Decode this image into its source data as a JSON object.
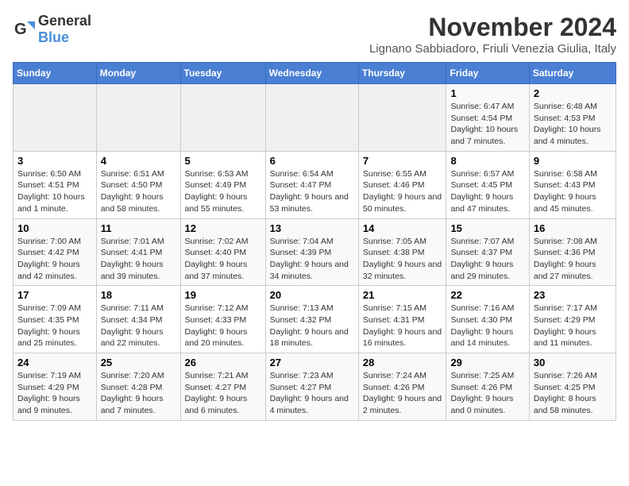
{
  "logo": {
    "text_general": "General",
    "text_blue": "Blue"
  },
  "title": "November 2024",
  "subtitle": "Lignano Sabbiadoro, Friuli Venezia Giulia, Italy",
  "days_of_week": [
    "Sunday",
    "Monday",
    "Tuesday",
    "Wednesday",
    "Thursday",
    "Friday",
    "Saturday"
  ],
  "weeks": [
    [
      {
        "day": "",
        "info": ""
      },
      {
        "day": "",
        "info": ""
      },
      {
        "day": "",
        "info": ""
      },
      {
        "day": "",
        "info": ""
      },
      {
        "day": "",
        "info": ""
      },
      {
        "day": "1",
        "info": "Sunrise: 6:47 AM\nSunset: 4:54 PM\nDaylight: 10 hours and 7 minutes."
      },
      {
        "day": "2",
        "info": "Sunrise: 6:48 AM\nSunset: 4:53 PM\nDaylight: 10 hours and 4 minutes."
      }
    ],
    [
      {
        "day": "3",
        "info": "Sunrise: 6:50 AM\nSunset: 4:51 PM\nDaylight: 10 hours and 1 minute."
      },
      {
        "day": "4",
        "info": "Sunrise: 6:51 AM\nSunset: 4:50 PM\nDaylight: 9 hours and 58 minutes."
      },
      {
        "day": "5",
        "info": "Sunrise: 6:53 AM\nSunset: 4:49 PM\nDaylight: 9 hours and 55 minutes."
      },
      {
        "day": "6",
        "info": "Sunrise: 6:54 AM\nSunset: 4:47 PM\nDaylight: 9 hours and 53 minutes."
      },
      {
        "day": "7",
        "info": "Sunrise: 6:55 AM\nSunset: 4:46 PM\nDaylight: 9 hours and 50 minutes."
      },
      {
        "day": "8",
        "info": "Sunrise: 6:57 AM\nSunset: 4:45 PM\nDaylight: 9 hours and 47 minutes."
      },
      {
        "day": "9",
        "info": "Sunrise: 6:58 AM\nSunset: 4:43 PM\nDaylight: 9 hours and 45 minutes."
      }
    ],
    [
      {
        "day": "10",
        "info": "Sunrise: 7:00 AM\nSunset: 4:42 PM\nDaylight: 9 hours and 42 minutes."
      },
      {
        "day": "11",
        "info": "Sunrise: 7:01 AM\nSunset: 4:41 PM\nDaylight: 9 hours and 39 minutes."
      },
      {
        "day": "12",
        "info": "Sunrise: 7:02 AM\nSunset: 4:40 PM\nDaylight: 9 hours and 37 minutes."
      },
      {
        "day": "13",
        "info": "Sunrise: 7:04 AM\nSunset: 4:39 PM\nDaylight: 9 hours and 34 minutes."
      },
      {
        "day": "14",
        "info": "Sunrise: 7:05 AM\nSunset: 4:38 PM\nDaylight: 9 hours and 32 minutes."
      },
      {
        "day": "15",
        "info": "Sunrise: 7:07 AM\nSunset: 4:37 PM\nDaylight: 9 hours and 29 minutes."
      },
      {
        "day": "16",
        "info": "Sunrise: 7:08 AM\nSunset: 4:36 PM\nDaylight: 9 hours and 27 minutes."
      }
    ],
    [
      {
        "day": "17",
        "info": "Sunrise: 7:09 AM\nSunset: 4:35 PM\nDaylight: 9 hours and 25 minutes."
      },
      {
        "day": "18",
        "info": "Sunrise: 7:11 AM\nSunset: 4:34 PM\nDaylight: 9 hours and 22 minutes."
      },
      {
        "day": "19",
        "info": "Sunrise: 7:12 AM\nSunset: 4:33 PM\nDaylight: 9 hours and 20 minutes."
      },
      {
        "day": "20",
        "info": "Sunrise: 7:13 AM\nSunset: 4:32 PM\nDaylight: 9 hours and 18 minutes."
      },
      {
        "day": "21",
        "info": "Sunrise: 7:15 AM\nSunset: 4:31 PM\nDaylight: 9 hours and 16 minutes."
      },
      {
        "day": "22",
        "info": "Sunrise: 7:16 AM\nSunset: 4:30 PM\nDaylight: 9 hours and 14 minutes."
      },
      {
        "day": "23",
        "info": "Sunrise: 7:17 AM\nSunset: 4:29 PM\nDaylight: 9 hours and 11 minutes."
      }
    ],
    [
      {
        "day": "24",
        "info": "Sunrise: 7:19 AM\nSunset: 4:29 PM\nDaylight: 9 hours and 9 minutes."
      },
      {
        "day": "25",
        "info": "Sunrise: 7:20 AM\nSunset: 4:28 PM\nDaylight: 9 hours and 7 minutes."
      },
      {
        "day": "26",
        "info": "Sunrise: 7:21 AM\nSunset: 4:27 PM\nDaylight: 9 hours and 6 minutes."
      },
      {
        "day": "27",
        "info": "Sunrise: 7:23 AM\nSunset: 4:27 PM\nDaylight: 9 hours and 4 minutes."
      },
      {
        "day": "28",
        "info": "Sunrise: 7:24 AM\nSunset: 4:26 PM\nDaylight: 9 hours and 2 minutes."
      },
      {
        "day": "29",
        "info": "Sunrise: 7:25 AM\nSunset: 4:26 PM\nDaylight: 9 hours and 0 minutes."
      },
      {
        "day": "30",
        "info": "Sunrise: 7:26 AM\nSunset: 4:25 PM\nDaylight: 8 hours and 58 minutes."
      }
    ]
  ]
}
